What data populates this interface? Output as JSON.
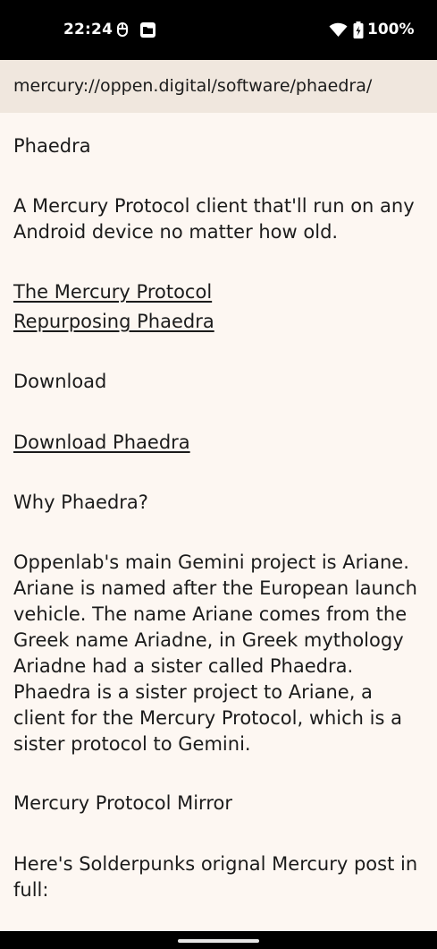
{
  "status_bar": {
    "time": "22:24",
    "battery": "100%",
    "icons": [
      "data-saver-icon",
      "folder-icon",
      "wifi-icon",
      "battery-icon"
    ]
  },
  "address_bar": {
    "url": "mercury://oppen.digital/software/phaedra/"
  },
  "page": {
    "title": "Phaedra",
    "intro": "A Mercury Protocol client that'll run on any Android device no matter how old.",
    "links": [
      "The Mercury Protocol",
      "Repurposing Phaedra"
    ],
    "download_heading": "Download",
    "download_link": "Download Phaedra",
    "why_heading": "Why Phaedra?",
    "why_body": "Oppenlab's main Gemini project is Ariane. Ariane is named after the European launch vehicle. The name Ariane comes from the Greek name Ariadne, in Greek mythology Ariadne had a sister called Phaedra. Phaedra is a sister project to Ariane, a client for the Mercury Protocol, which is a sister protocol to Gemini.",
    "mirror_heading": "Mercury Protocol Mirror",
    "mirror_body": "Here's Solderpunks orignal Mercury post in full:"
  },
  "colors": {
    "background": "#fdf7f2",
    "address_bar": "#f0e7de",
    "text": "#1b1b1b"
  }
}
